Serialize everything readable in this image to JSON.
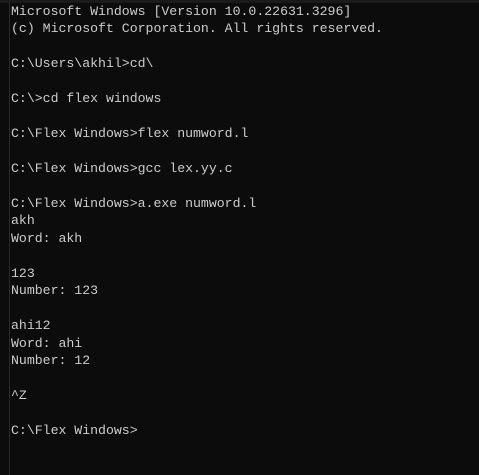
{
  "console": {
    "lines": [
      "Microsoft Windows [Version 10.0.22631.3296]",
      "(c) Microsoft Corporation. All rights reserved.",
      "",
      "C:\\Users\\akhil>cd\\",
      "",
      "C:\\>cd flex windows",
      "",
      "C:\\Flex Windows>flex numword.l",
      "",
      "C:\\Flex Windows>gcc lex.yy.c",
      "",
      "C:\\Flex Windows>a.exe numword.l",
      "akh",
      "Word: akh",
      "",
      "123",
      "Number: 123",
      "",
      "ahi12",
      "Word: ahi",
      "Number: 12",
      "",
      "^Z",
      "",
      "C:\\Flex Windows>"
    ]
  },
  "colors": {
    "background": "#0c0c0c",
    "text": "#cccccc"
  }
}
